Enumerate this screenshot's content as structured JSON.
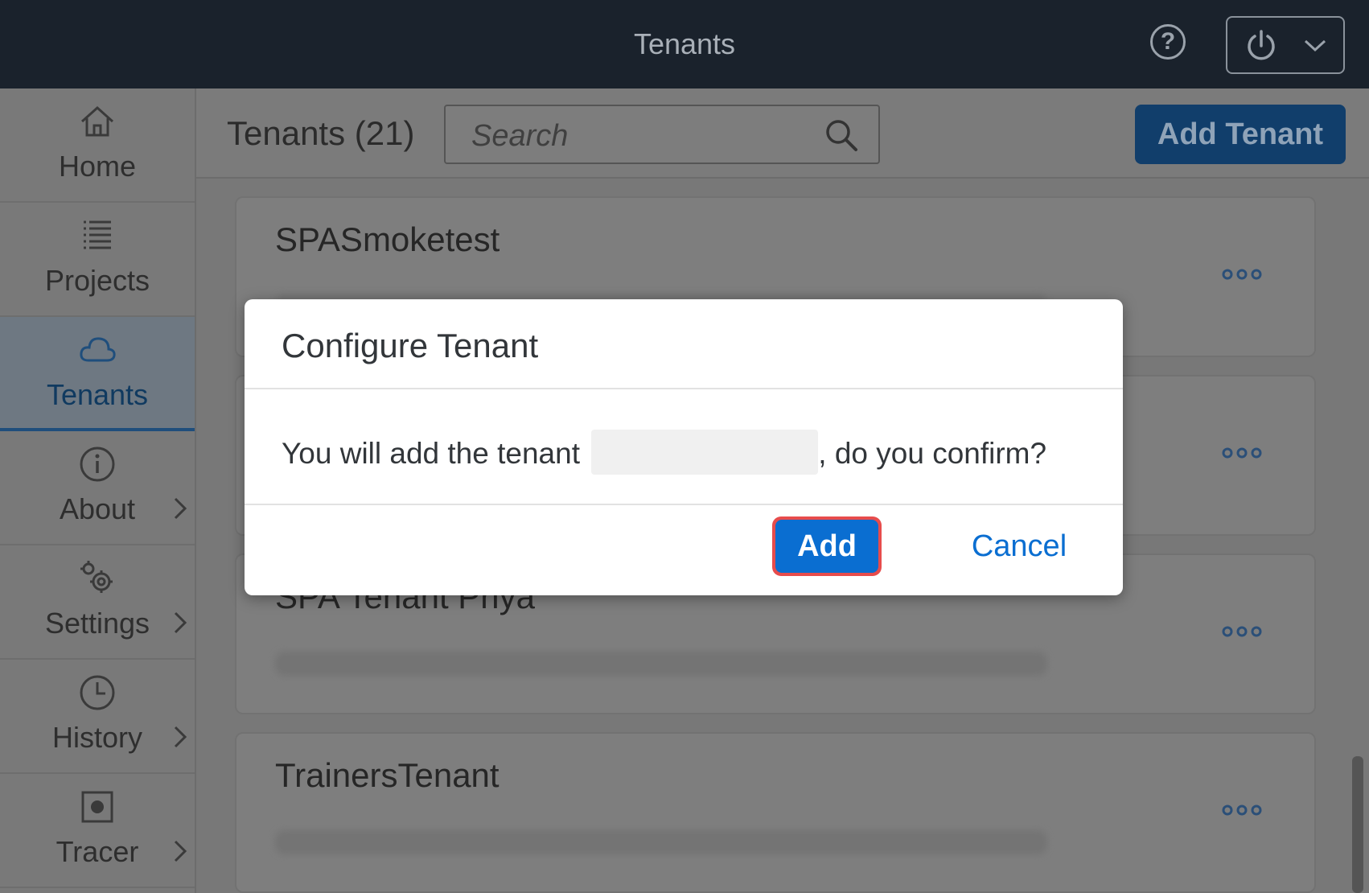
{
  "shell": {
    "title": "Tenants",
    "help_symbol": "?"
  },
  "sidebar": {
    "items": [
      {
        "label": "Home",
        "icon": "home-icon"
      },
      {
        "label": "Projects",
        "icon": "list-icon"
      },
      {
        "label": "Tenants",
        "icon": "cloud-icon",
        "selected": true
      },
      {
        "label": "About",
        "icon": "info-icon"
      },
      {
        "label": "Settings",
        "icon": "settings-icon"
      },
      {
        "label": "History",
        "icon": "clock-icon"
      },
      {
        "label": "Tracer",
        "icon": "record-icon"
      }
    ]
  },
  "toolbar": {
    "title": "Tenants (21)",
    "search_placeholder": "Search",
    "add_tenant_label": "Add Tenant"
  },
  "tenants": [
    {
      "name": "SPASmoketest"
    },
    {
      "name": ""
    },
    {
      "name": "SPA Tenant Priya"
    },
    {
      "name": "TrainersTenant"
    }
  ],
  "dialog": {
    "title": "Configure Tenant",
    "message_prefix": "You will add the tenant",
    "message_suffix": ", do you confirm?",
    "add_label": "Add",
    "cancel_label": "Cancel"
  },
  "colors": {
    "shell_bg": "#1a222c",
    "accent": "#0a6ed1",
    "highlight_border": "#e74c4c",
    "overlay_gray": "#7a7a7a"
  }
}
